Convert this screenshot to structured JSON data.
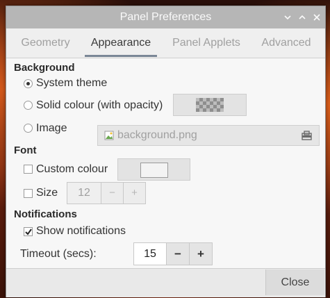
{
  "window": {
    "title": "Panel Preferences"
  },
  "tabs": [
    {
      "label": "Geometry",
      "active": false
    },
    {
      "label": "Appearance",
      "active": true
    },
    {
      "label": "Panel Applets",
      "active": false
    },
    {
      "label": "Advanced",
      "active": false
    }
  ],
  "background": {
    "heading": "Background",
    "options": [
      {
        "label": "System theme",
        "selected": true
      },
      {
        "label": "Solid colour (with opacity)",
        "selected": false
      },
      {
        "label": "Image",
        "selected": false
      }
    ],
    "image_file": "background.png"
  },
  "font": {
    "heading": "Font",
    "custom_colour_label": "Custom colour",
    "custom_colour_checked": false,
    "size_label": "Size",
    "size_checked": false,
    "size_value": "12",
    "minus": "−",
    "plus": "+"
  },
  "notifications": {
    "heading": "Notifications",
    "show_label": "Show notifications",
    "show_checked": true,
    "timeout_label": "Timeout (secs):",
    "timeout_value": "15",
    "minus": "−",
    "plus": "+"
  },
  "footer": {
    "close_label": "Close"
  },
  "icons": {
    "minimize": "chevron-down-icon",
    "maximize": "chevron-up-icon",
    "close": "close-icon",
    "file": "image-file-icon",
    "browse": "folder-open-icon"
  }
}
